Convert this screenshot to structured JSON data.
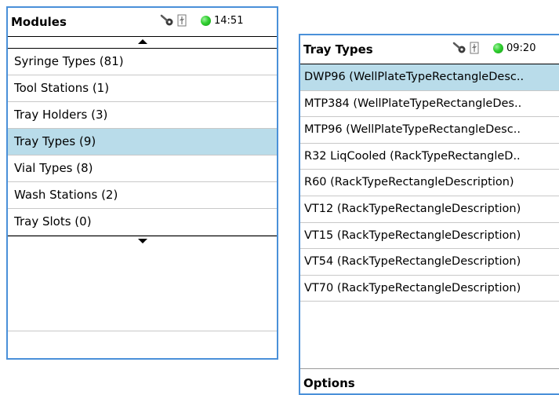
{
  "modules": {
    "title": "Modules",
    "time": "14:51",
    "items": [
      {
        "label": "Syringe Types (81)",
        "selected": false
      },
      {
        "label": "Tool Stations (1)",
        "selected": false
      },
      {
        "label": "Tray Holders (3)",
        "selected": false
      },
      {
        "label": "Tray Types (9)",
        "selected": true
      },
      {
        "label": "Vial Types (8)",
        "selected": false
      },
      {
        "label": "Wash Stations (2)",
        "selected": false
      },
      {
        "label": "Tray Slots (0)",
        "selected": false
      }
    ]
  },
  "tray_types": {
    "title": "Tray Types",
    "time": "09:20",
    "items": [
      {
        "label": "DWP96 (WellPlateTypeRectangleDesc..",
        "selected": true
      },
      {
        "label": "MTP384 (WellPlateTypeRectangleDes..",
        "selected": false
      },
      {
        "label": "MTP96 (WellPlateTypeRectangleDesc..",
        "selected": false
      },
      {
        "label": "R32 LiqCooled (RackTypeRectangleD..",
        "selected": false
      },
      {
        "label": "R60 (RackTypeRectangleDescription)",
        "selected": false
      },
      {
        "label": "VT12 (RackTypeRectangleDescription)",
        "selected": false
      },
      {
        "label": "VT15 (RackTypeRectangleDescription)",
        "selected": false
      },
      {
        "label": "VT54 (RackTypeRectangleDescription)",
        "selected": false
      },
      {
        "label": "VT70 (RackTypeRectangleDescription)",
        "selected": false
      }
    ],
    "options_label": "Options"
  },
  "icons": {
    "tool": "wrench-key-icon",
    "usb": "usb-icon",
    "status_led": "status-led-icon"
  },
  "colors": {
    "panel_border": "#4a90d9",
    "selection": "#b9dcea",
    "status_led": "#2fcf2f"
  }
}
